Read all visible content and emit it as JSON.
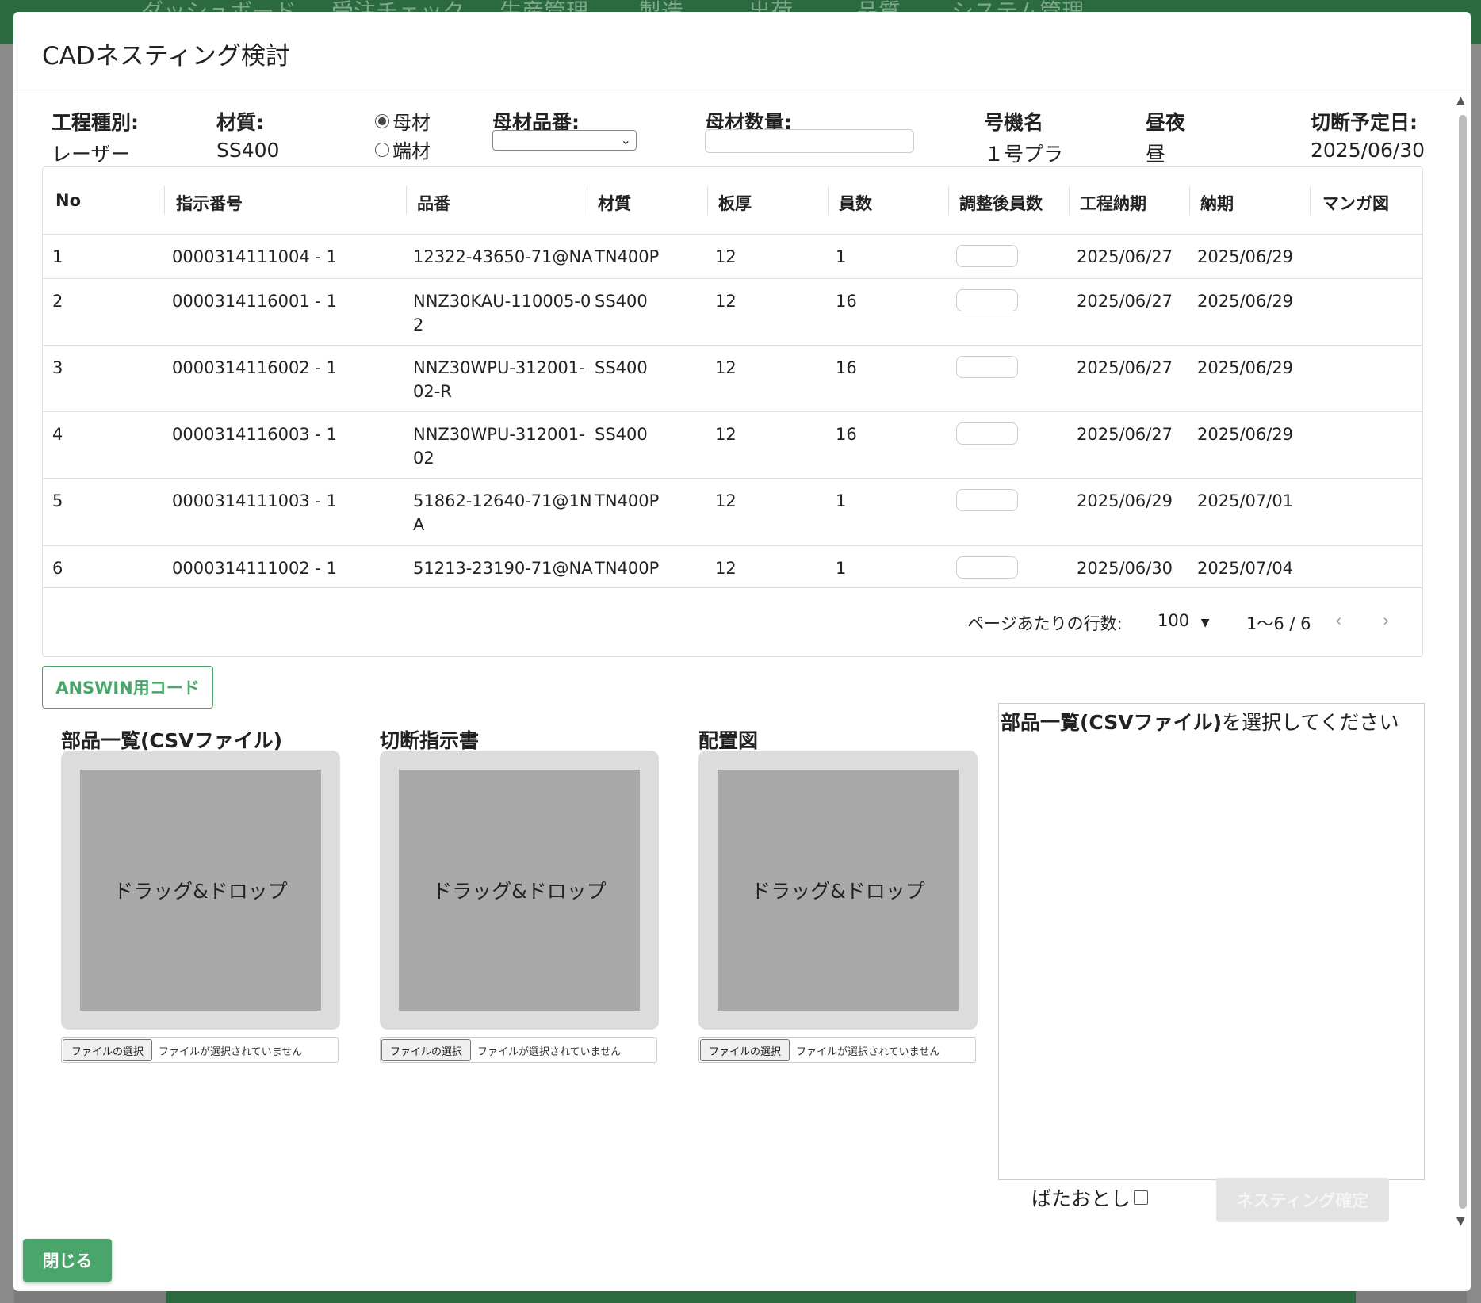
{
  "background": {
    "nav_items": [
      "ダッシュボード",
      "受注チェック",
      "生産管理",
      "製造",
      "出荷",
      "品質",
      "システム管理"
    ]
  },
  "modal": {
    "title": "CADネスティング検討",
    "fields": {
      "process_type_label": "工程種別:",
      "process_type_value": "レーザー",
      "material_label": "材質:",
      "material_value": "SS400",
      "radio_mother": "母材",
      "radio_mother_selected": true,
      "radio_end": "端材",
      "mother_part_label": "母材品番:",
      "mother_part_value": "",
      "mother_qty_label": "母材数量:",
      "mother_qty_value": "",
      "machine_label": "号機名",
      "machine_value": "１号プラ",
      "shift_label": "昼夜",
      "shift_value": "昼",
      "cut_date_label": "切断予定日:",
      "cut_date_value": "2025/06/30"
    },
    "table": {
      "headers": [
        "No",
        "指示番号",
        "品番",
        "材質",
        "板厚",
        "員数",
        "調整後員数",
        "工程納期",
        "納期",
        "マンガ図"
      ],
      "rows": [
        {
          "no": "1",
          "order": "0000314111004 - 1",
          "part": [
            "12322-43650-71@NA"
          ],
          "material": "TN400P",
          "thickness": "12",
          "qty": "1",
          "adjusted": "",
          "process_due": "2025/06/27",
          "due": "2025/06/29",
          "manga": ""
        },
        {
          "no": "2",
          "order": "0000314116001 - 1",
          "part": [
            "NNZ30KAU-110005-0",
            "2"
          ],
          "material": "SS400",
          "thickness": "12",
          "qty": "16",
          "adjusted": "",
          "process_due": "2025/06/27",
          "due": "2025/06/29",
          "manga": ""
        },
        {
          "no": "3",
          "order": "0000314116002 - 1",
          "part": [
            "NNZ30WPU-312001-",
            "02-R"
          ],
          "material": "SS400",
          "thickness": "12",
          "qty": "16",
          "adjusted": "",
          "process_due": "2025/06/27",
          "due": "2025/06/29",
          "manga": ""
        },
        {
          "no": "4",
          "order": "0000314116003 - 1",
          "part": [
            "NNZ30WPU-312001-",
            "02"
          ],
          "material": "SS400",
          "thickness": "12",
          "qty": "16",
          "adjusted": "",
          "process_due": "2025/06/27",
          "due": "2025/06/29",
          "manga": ""
        },
        {
          "no": "5",
          "order": "0000314111003 - 1",
          "part": [
            "51862-12640-71@1N",
            "A"
          ],
          "material": "TN400P",
          "thickness": "12",
          "qty": "1",
          "adjusted": "",
          "process_due": "2025/06/29",
          "due": "2025/07/01",
          "manga": ""
        },
        {
          "no": "6",
          "order": "0000314111002 - 1",
          "part": [
            "51213-23190-71@NA"
          ],
          "material": "TN400P",
          "thickness": "12",
          "qty": "1",
          "adjusted": "",
          "process_due": "2025/06/30",
          "due": "2025/07/04",
          "manga": ""
        }
      ],
      "footer": {
        "rows_per_page_label": "ページあたりの行数:",
        "rows_per_page_value": "100",
        "range": "1〜6 / 6"
      }
    },
    "answin_button": "ANSWIN用コード",
    "uploads": [
      {
        "label": "部品一覧(CSVファイル)",
        "drop_text": "ドラッグ&ドロップ",
        "file_button": "ファイルの選択",
        "file_status": "ファイルが選択されていません"
      },
      {
        "label": "切断指示書",
        "drop_text": "ドラッグ&ドロップ",
        "file_button": "ファイルの選択",
        "file_status": "ファイルが選択されていません"
      },
      {
        "label": "配置図",
        "drop_text": "ドラッグ&ドロップ",
        "file_button": "ファイルの選択",
        "file_status": "ファイルが選択されていません"
      }
    ],
    "message": {
      "bold": "部品一覧(CSVファイル)",
      "rest": "を選択してください"
    },
    "batadoshi_label": "ばたおとし",
    "nesting_confirm_button": "ネスティング確定",
    "close_button": "閉じる"
  },
  "colors": {
    "accent": "#4aa56a",
    "nav_background": "#2b6a3e",
    "drop_outer": "#dcdcdc",
    "drop_inner": "#a9a9a9"
  }
}
